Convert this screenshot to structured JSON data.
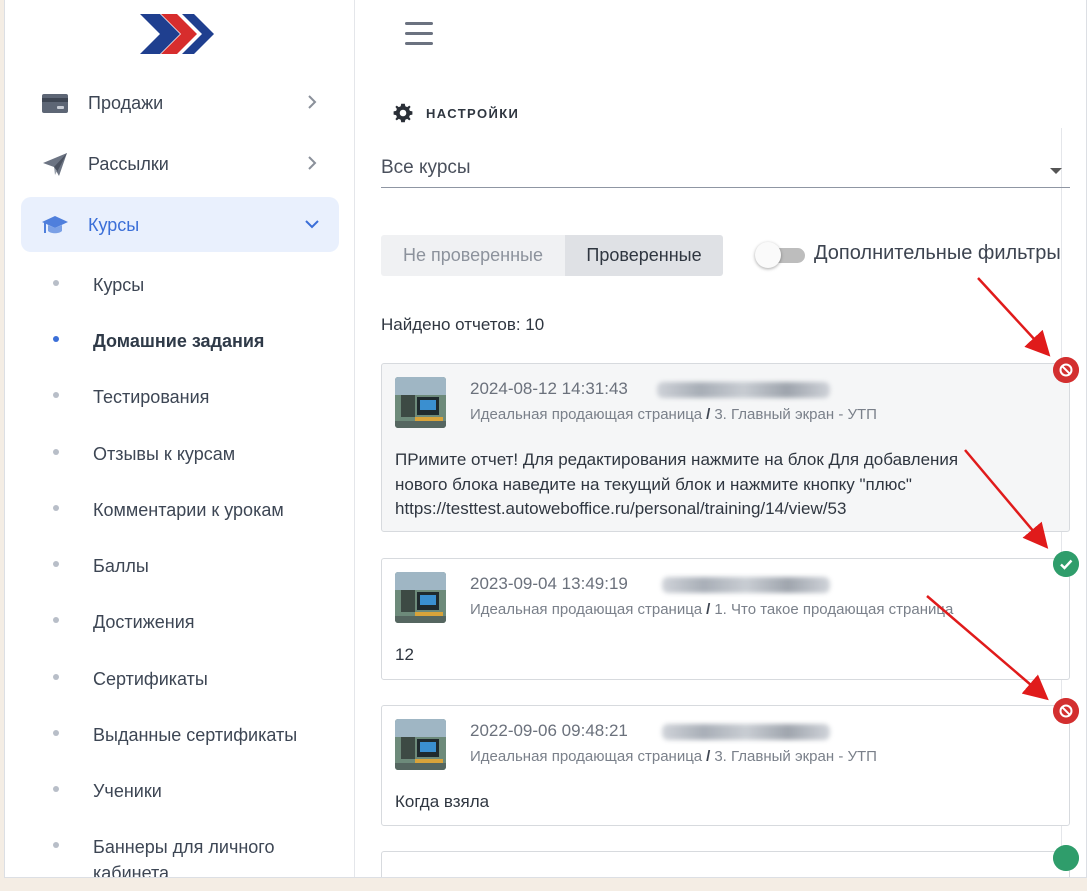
{
  "sidebar": {
    "items": [
      {
        "label": "Продажи",
        "icon": "card-icon"
      },
      {
        "label": "Рассылки",
        "icon": "paper-plane-icon"
      },
      {
        "label": "Курсы",
        "icon": "graduation-cap-icon"
      }
    ],
    "sub_items": [
      "Курсы",
      "Домашние задания",
      "Тестирования",
      "Отзывы к курсам",
      "Комментарии к урокам",
      "Баллы",
      "Достижения",
      "Сертификаты",
      "Выданные сертификаты",
      "Ученики",
      "Баннеры для личного кабинета"
    ]
  },
  "header": {
    "settings_label": "НАСТРОЙКИ"
  },
  "filters": {
    "course_select": "Все курсы",
    "tab_unchecked": "Не проверенные",
    "tab_checked": "Проверенные",
    "extra_filters": "Дополнительные фильтры",
    "found": "Найдено отчетов: 10"
  },
  "reports": [
    {
      "date": "2024-08-12 14:31:43",
      "course": "Идеальная продающая страница",
      "lesson": "3. Главный экран - УТП",
      "text_lines": [
        "ПРимите отчет! Для редактирования нажмите на блок Для добавления",
        "нового блока наведите на текущий блок и нажмите кнопку \"плюс\"",
        "https://testtest.autowebоffice.ru/personal/training/14/view/53"
      ],
      "status": "rejected"
    },
    {
      "date": "2023-09-04 13:49:19",
      "course": "Идеальная продающая страница",
      "lesson": "1. Что такое продающая страница",
      "text_lines": [
        "12"
      ],
      "status": "accepted"
    },
    {
      "date": "2022-09-06 09:48:21",
      "course": "Идеальная продающая страница",
      "lesson": "3. Главный экран - УТП",
      "text_lines": [
        "Когда взяла"
      ],
      "status": "rejected"
    }
  ],
  "colors": {
    "accent": "#3b6fd8",
    "active_bg": "#e9f0fd",
    "rejected": "#d32f2f",
    "accepted": "#2f9d6b",
    "annotation_arrow": "#e01b1b"
  }
}
